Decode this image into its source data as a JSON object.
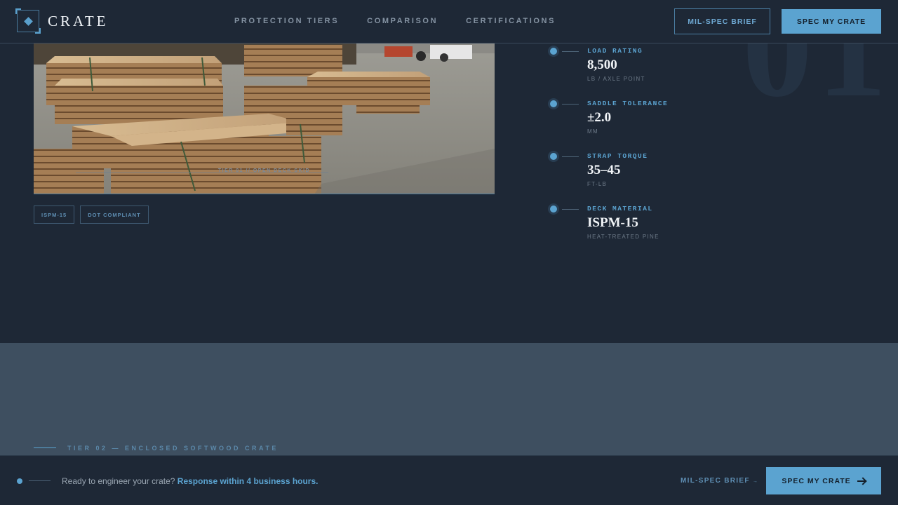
{
  "brand": {
    "name": "CRATE"
  },
  "nav": {
    "items": [
      {
        "label": "PROTECTION TIERS"
      },
      {
        "label": "COMPARISON"
      },
      {
        "label": "CERTIFICATIONS"
      }
    ]
  },
  "header": {
    "brief_label": "MIL-SPEC BRIEF",
    "cta_label": "SPEC MY CRATE"
  },
  "hero": {
    "caption": "TIER 01 // OPEN DECK SKID",
    "tags": [
      "ISPM-15",
      "DOT COMPLIANT"
    ],
    "watermark": "01"
  },
  "specs": [
    {
      "label": "LOAD RATING",
      "value": "8,500",
      "unit": "LB / AXLE POINT"
    },
    {
      "label": "SADDLE TOLERANCE",
      "value": "±2.0",
      "unit": "MM"
    },
    {
      "label": "STRAP TORQUE",
      "value": "35–45",
      "unit": "FT-LB"
    },
    {
      "label": "DECK MATERIAL",
      "value": "ISPM-15",
      "unit": "HEAT-TREATED PINE"
    }
  ],
  "next_tier": {
    "label": "TIER 02 — ENCLOSED SOFTWOOD CRATE"
  },
  "footer": {
    "prompt": "Ready to engineer your crate?",
    "prompt_highlight": "Response within 4 business hours.",
    "brief_link": "MIL-SPEC BRIEF",
    "brief_arrow": "→",
    "cta_label": "SPEC MY CRATE"
  },
  "colors": {
    "accent": "#5ba3d0",
    "background": "#1e2836",
    "band": "#3e4f60"
  }
}
